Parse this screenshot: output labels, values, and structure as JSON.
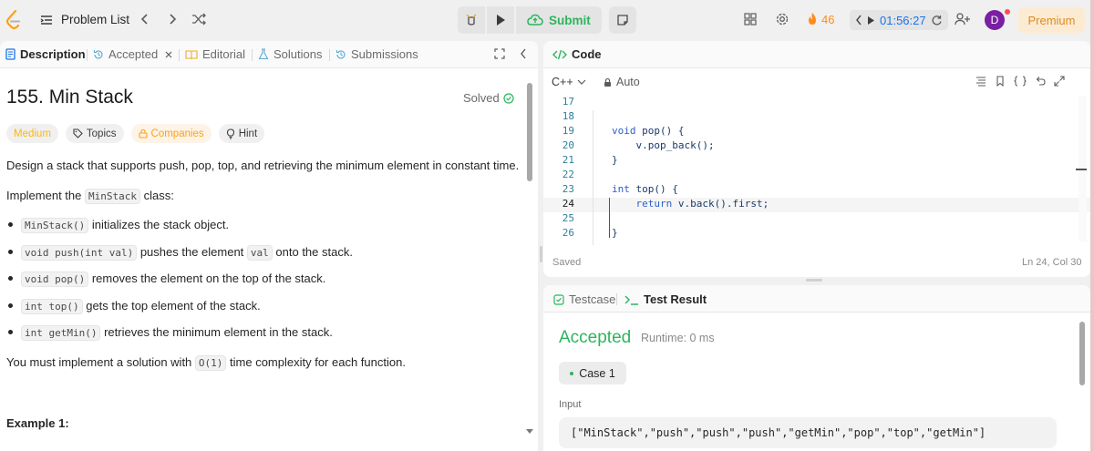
{
  "topbar": {
    "problem_list": "Problem List",
    "submit": "Submit",
    "streak": "46",
    "timer": "01:56:27",
    "avatar_letter": "D",
    "premium": "Premium"
  },
  "tabs": {
    "description": "Description",
    "accepted": "Accepted",
    "editorial": "Editorial",
    "solutions": "Solutions",
    "submissions": "Submissions"
  },
  "problem": {
    "title": "155. Min Stack",
    "solved": "Solved",
    "tags": [
      "Medium",
      "Topics",
      "Companies",
      "Hint"
    ],
    "intro": "Design a stack that supports push, pop, top, and retrieving the minimum element in constant time.",
    "impl_pre": "Implement the ",
    "impl_code": "MinStack",
    "impl_post": " class:",
    "bullets": [
      {
        "code": "MinStack()",
        "text": " initializes the stack object."
      },
      {
        "code": "void push(int val)",
        "text": " pushes the element ",
        "code2": "val",
        "text2": " onto the stack."
      },
      {
        "code": "void pop()",
        "text": " removes the element on the top of the stack."
      },
      {
        "code": "int top()",
        "text": " gets the top element of the stack."
      },
      {
        "code": "int getMin()",
        "text": " retrieves the minimum element in the stack."
      }
    ],
    "complexity_pre": "You must implement a solution with ",
    "complexity_code": "O(1)",
    "complexity_post": " time complexity for each function.",
    "example": "Example 1:"
  },
  "code": {
    "header": "Code",
    "language": "C++",
    "mode": "Auto",
    "lines": [
      {
        "n": "17",
        "t": ""
      },
      {
        "n": "18",
        "t": ""
      },
      {
        "n": "19",
        "kw": "void",
        "t": " pop() {"
      },
      {
        "n": "20",
        "t": "    v.pop_back();"
      },
      {
        "n": "21",
        "t": "}"
      },
      {
        "n": "22",
        "t": ""
      },
      {
        "n": "23",
        "kw": "int",
        "t": " top() {"
      },
      {
        "n": "24",
        "kwi": "    return",
        "t": " v.back().first;"
      },
      {
        "n": "25",
        "t": ""
      },
      {
        "n": "26",
        "t": "}"
      }
    ],
    "saved": "Saved",
    "position": "Ln 24, Col 30"
  },
  "result": {
    "testcase_tab": "Testcase",
    "result_tab": "Test Result",
    "status": "Accepted",
    "runtime": "Runtime: 0 ms",
    "case": "Case 1",
    "input_label": "Input",
    "input_value": "[\"MinStack\",\"push\",\"push\",\"push\",\"getMin\",\"pop\",\"top\",\"getMin\"]"
  },
  "colors": {
    "accent_green": "#2cb55d",
    "brand_orange": "#ffa116",
    "timer_blue": "#1a73e8"
  }
}
